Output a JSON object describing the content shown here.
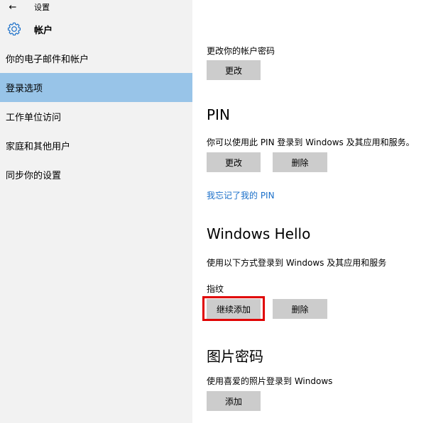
{
  "titlebar": {
    "title": "设置",
    "back_glyph": "←"
  },
  "header": {
    "icon": "gear-icon",
    "title": "帐户"
  },
  "sidebar": {
    "items": [
      {
        "label": "你的电子邮件和帐户",
        "selected": false
      },
      {
        "label": "登录选项",
        "selected": true
      },
      {
        "label": "工作单位访问",
        "selected": false
      },
      {
        "label": "家庭和其他用户",
        "selected": false
      },
      {
        "label": "同步你的设置",
        "selected": false
      }
    ]
  },
  "password": {
    "description": "更改你的帐户密码",
    "change_label": "更改"
  },
  "pin": {
    "heading": "PIN",
    "description": "你可以使用此 PIN 登录到 Windows 及其应用和服务。",
    "change_label": "更改",
    "remove_label": "删除",
    "forgot_link": "我忘记了我的 PIN"
  },
  "hello": {
    "heading": "Windows Hello",
    "description": "使用以下方式登录到 Windows 及其应用和服务",
    "fingerprint_label": "指纹",
    "add_more_label": "继续添加",
    "remove_label": "删除"
  },
  "picture_password": {
    "heading": "图片密码",
    "description": "使用喜爱的照片登录到 Windows",
    "add_label": "添加"
  },
  "colors": {
    "sidebar_bg": "#f2f2f2",
    "selected_bg": "#98c4e8",
    "button_bg": "#cccccc",
    "link": "#1a6fc9",
    "highlight": "#e00000"
  }
}
